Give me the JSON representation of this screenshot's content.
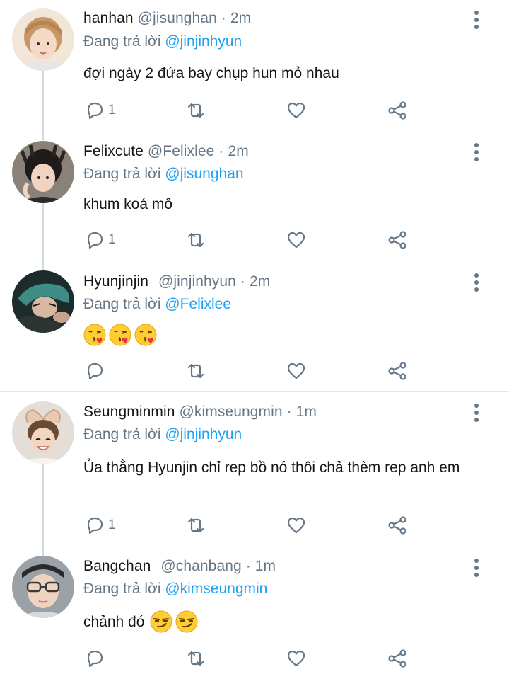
{
  "tweets": [
    {
      "name": "hanhan",
      "handle": "@jisunghan",
      "sep": "·",
      "time": "2m",
      "reply_prefix": "Đang trả lời",
      "reply_to": "@jinjinhyun",
      "text": "đợi ngày 2 đứa bay chụp hun mỏ nhau",
      "reply_count": "1",
      "avatar_color": "#e8c9a6"
    },
    {
      "name": "Felixcute",
      "handle": "@Felixlee",
      "sep": "·",
      "time": "2m",
      "reply_prefix": "Đang trả lời",
      "reply_to": "@jisunghan",
      "text": "khum koá mô",
      "reply_count": "1",
      "avatar_color": "#3a3533"
    },
    {
      "name": "Hyunjinjin",
      "handle": "@jinjinhyun",
      "sep": "·",
      "time": "2m",
      "reply_prefix": "Đang trả lời",
      "reply_to": "@Felixlee",
      "emojis": [
        "face-blowing-kiss-icon",
        "face-blowing-kiss-icon",
        "face-blowing-kiss-icon"
      ],
      "reply_count": "",
      "avatar_color": "#2f5b5a"
    },
    {
      "name": "Seungminmin",
      "handle": "@kimseungmin",
      "sep": "·",
      "time": "1m",
      "reply_prefix": "Đang trả lời",
      "reply_to": "@jinjinhyun",
      "text": "Ủa thằng Hyunjin chỉ rep bồ nó thôi chả thèm rep anh em",
      "reply_count": "1",
      "avatar_color": "#d8c2a8"
    },
    {
      "name": "Bangchan",
      "handle": "@chanbang",
      "sep": "·",
      "time": "1m",
      "reply_prefix": "Đang trả lời",
      "reply_to": "@kimseungmin",
      "text": "chảnh đó",
      "emojis": [
        "smirking-face-icon",
        "smirking-face-icon"
      ],
      "reply_count": "",
      "avatar_color": "#5a5f66"
    }
  ],
  "colors": {
    "mention": "#1da1f2",
    "secondary_text": "#657786",
    "icon": "#657786",
    "thread_line": "#cfd9de"
  }
}
